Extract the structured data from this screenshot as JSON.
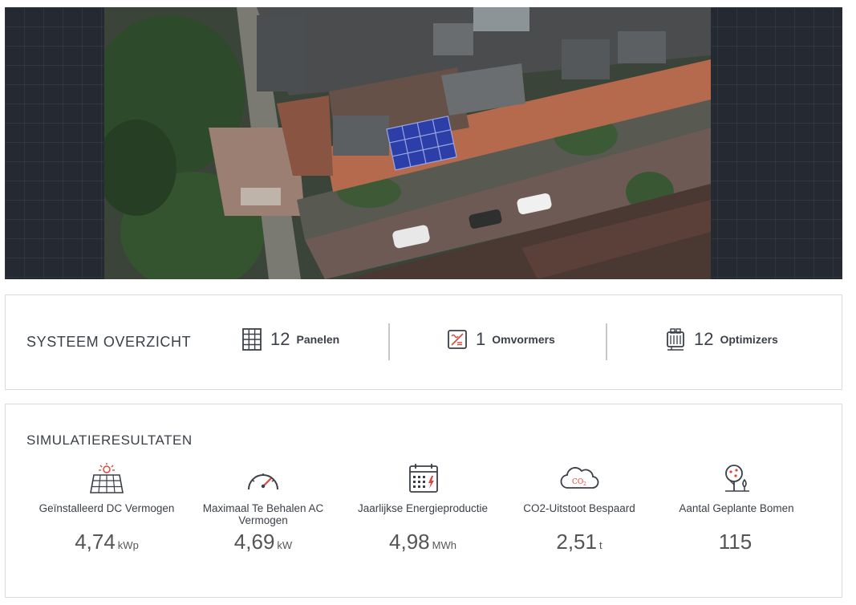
{
  "map": {
    "icon": "aerial-satellite-view"
  },
  "overview": {
    "title": "SYSTEEM OVERZICHT",
    "items": [
      {
        "icon": "solar-panel-grid-icon",
        "count": "12",
        "label": "Panelen"
      },
      {
        "icon": "inverter-icon",
        "count": "1",
        "label": "Omvormers"
      },
      {
        "icon": "optimizer-icon",
        "count": "12",
        "label": "Optimizers"
      }
    ]
  },
  "simulation": {
    "title": "SIMULATIERESULTATEN",
    "items": [
      {
        "icon": "solar-array-sun-icon",
        "label": "Geïnstalleerd DC Vermogen",
        "value": "4,74",
        "unit": "kWp"
      },
      {
        "icon": "speedometer-icon",
        "label": "Maximaal Te Behalen AC Vermogen",
        "value": "4,69",
        "unit": "kW"
      },
      {
        "icon": "calendar-energy-icon",
        "label": "Jaarlijkse Energieproductie",
        "value": "4,98",
        "unit": "MWh"
      },
      {
        "icon": "co2-cloud-icon",
        "label": "CO2-Uitstoot Bespaard",
        "value": "2,51",
        "unit": "t"
      },
      {
        "icon": "trees-icon",
        "label": "Aantal Geplante Bomen",
        "value": "115",
        "unit": ""
      }
    ]
  },
  "colors": {
    "accent_red": "#e0453a",
    "panel_blue": "#2c3fa8",
    "text_dark": "#3b3f47"
  }
}
